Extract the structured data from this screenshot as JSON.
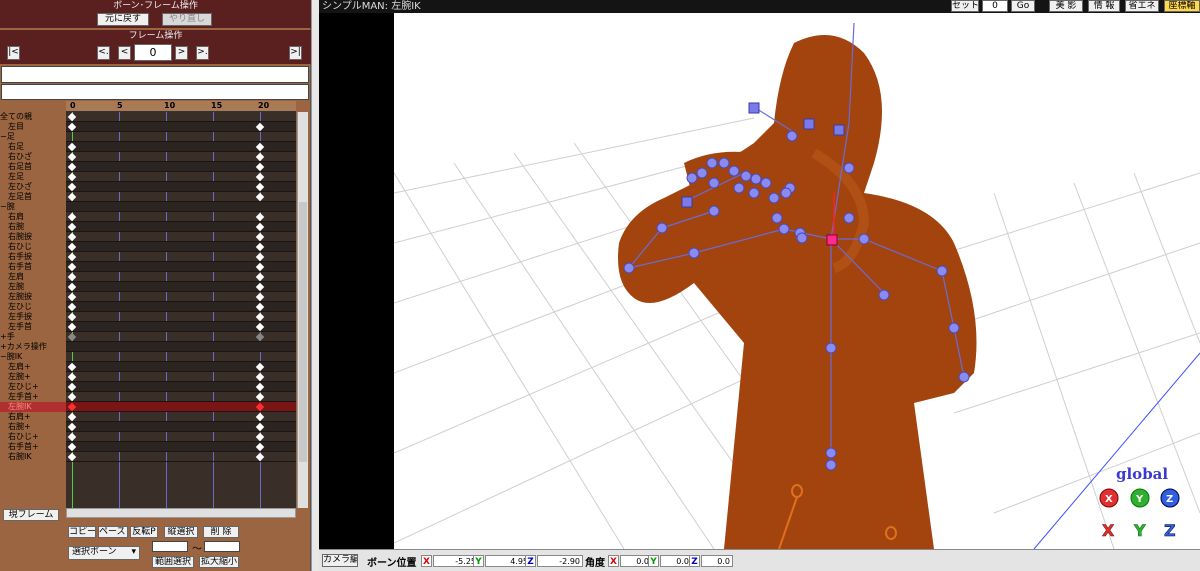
{
  "left_panel": {
    "bone_frame_title": "ボーン･フレーム操作",
    "undo": "元に戻す",
    "redo": "やり直し",
    "frame_title": "フレーム操作",
    "frame_first": "|<",
    "frame_prev_key": "<.",
    "frame_prev": "<",
    "frame_value": "0",
    "frame_next": ">",
    "frame_next_key": ">.",
    "frame_last": ">|",
    "ruler_ticks": [
      "0",
      "5",
      "10",
      "15",
      "20"
    ],
    "bones": [
      {
        "label": "全ての親",
        "keys": [
          0
        ]
      },
      {
        "label": "　左目",
        "keys": [
          0,
          20
        ]
      },
      {
        "label": "−足",
        "keys": []
      },
      {
        "label": "　右足",
        "keys": [
          0,
          20
        ]
      },
      {
        "label": "　右ひざ",
        "keys": [
          0,
          20
        ]
      },
      {
        "label": "　右足首",
        "keys": [
          0,
          20
        ]
      },
      {
        "label": "　左足",
        "keys": [
          0,
          20
        ]
      },
      {
        "label": "　左ひざ",
        "keys": [
          0,
          20
        ]
      },
      {
        "label": "　左足首",
        "keys": [
          0,
          20
        ]
      },
      {
        "label": "−腕",
        "keys": []
      },
      {
        "label": "　右肩",
        "keys": [
          0,
          20
        ]
      },
      {
        "label": "　右腕",
        "keys": [
          0,
          20
        ]
      },
      {
        "label": "　右腕捩",
        "keys": [
          0,
          20
        ]
      },
      {
        "label": "　右ひじ",
        "keys": [
          0,
          20
        ]
      },
      {
        "label": "　右手捩",
        "keys": [
          0,
          20
        ]
      },
      {
        "label": "　右手首",
        "keys": [
          0,
          20
        ]
      },
      {
        "label": "　左肩",
        "keys": [
          0,
          20
        ]
      },
      {
        "label": "　左腕",
        "keys": [
          0,
          20
        ]
      },
      {
        "label": "　左腕捩",
        "keys": [
          0,
          20
        ]
      },
      {
        "label": "　左ひじ",
        "keys": [
          0,
          20
        ]
      },
      {
        "label": "　左手捩",
        "keys": [
          0,
          20
        ]
      },
      {
        "label": "　左手首",
        "keys": [
          0,
          20
        ]
      },
      {
        "label": "+手",
        "keys": [
          0,
          20
        ],
        "grey": true
      },
      {
        "label": "+カメラ操作",
        "keys": []
      },
      {
        "label": "−腕IK",
        "keys": []
      },
      {
        "label": "　左肩+",
        "keys": [
          0,
          20
        ]
      },
      {
        "label": "　左腕+",
        "keys": [
          0,
          20
        ]
      },
      {
        "label": "　左ひじ+",
        "keys": [
          0,
          20
        ]
      },
      {
        "label": "　左手首+",
        "keys": [
          0,
          20
        ]
      },
      {
        "label": "　左腕IK",
        "keys": [
          0,
          20
        ],
        "selected": true
      },
      {
        "label": "　右肩+",
        "keys": [
          0,
          20
        ]
      },
      {
        "label": "　右腕+",
        "keys": [
          0,
          20
        ]
      },
      {
        "label": "　右ひじ+",
        "keys": [
          0,
          20
        ]
      },
      {
        "label": "　右手首+",
        "keys": [
          0,
          20
        ]
      },
      {
        "label": "　右腕IK",
        "keys": [
          0,
          20
        ]
      }
    ],
    "current_frame_btn": "現フレーム",
    "copy": "コピー",
    "paste": "ペースト",
    "flip": "反転P",
    "vsel": "縦選択",
    "delete": "削 除",
    "select_bone": "選択ボーン",
    "tilde": "〜",
    "range_sel": "範囲選択",
    "scale": "拡大縮小"
  },
  "view": {
    "title": "シンプルMAN: 左腕IK",
    "set": "セット",
    "go_value": "0",
    "go": "Go",
    "b1": "美 影",
    "b2": "情 報",
    "b3": "省エネ",
    "b4": "座標軸",
    "global": "global",
    "ax_x": "X",
    "ax_y": "Y",
    "ax_z": "Z"
  },
  "bottom": {
    "camera_btn": "カメラ編",
    "pos_label": "ボーン位置",
    "x": "X",
    "y": "Y",
    "z": "Z",
    "pos_x": "-5.25",
    "pos_y": "4.95",
    "pos_z": "-2.90",
    "rot_label": "角度",
    "rot_x": "0.0",
    "rot_y": "0.0",
    "rot_z": "0.0"
  },
  "colors": {
    "panel_brown": "#9a6540",
    "header_red": "#5a1f1f",
    "model_brown": "#a3440e",
    "bone_blue": "#6b6bd6",
    "selected_row": "#b03030"
  }
}
